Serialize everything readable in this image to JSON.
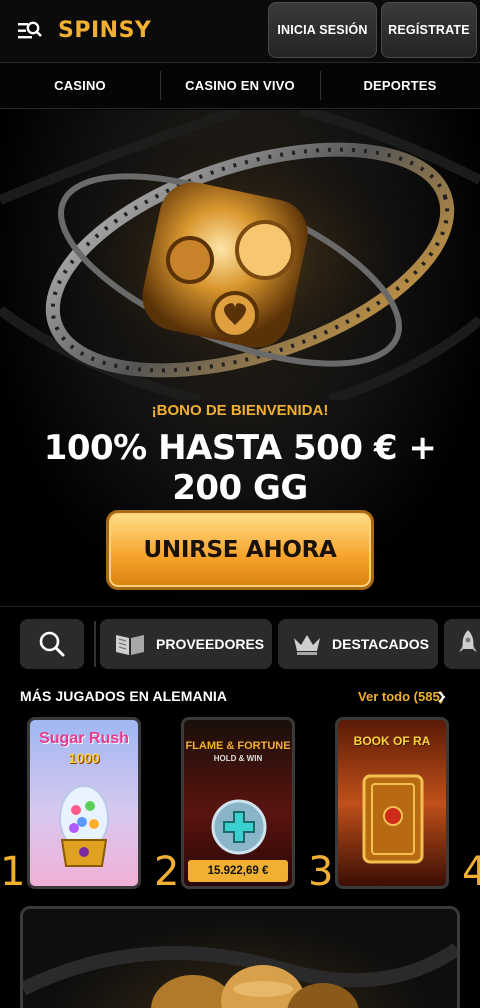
{
  "header": {
    "logo": "SPINSY",
    "login_label": "INICIA SESIÓN",
    "register_label": "REGÍSTRATE",
    "menu_icon": "menu-search-icon"
  },
  "nav": {
    "items": [
      "CASINO",
      "CASINO EN VIVO",
      "DEPORTES"
    ]
  },
  "hero": {
    "bonus_label": "¡BONO DE BIENVENIDA!",
    "bonus_title": "100% HASTA 500 € + 200 GG",
    "cta_label": "UNIRSE AHORA"
  },
  "filters": {
    "search_icon": "search-icon",
    "chips": [
      {
        "label": "PROVEEDORES",
        "icon": "book-icon"
      },
      {
        "label": "DESTACADOS",
        "icon": "crown-icon"
      },
      {
        "label": "",
        "icon": "rocket-icon"
      }
    ]
  },
  "section": {
    "title": "MÁS JUGADOS EN ALEMANIA",
    "see_all": "Ver todo (585)"
  },
  "games": [
    {
      "rank": "1",
      "title_line1": "Sugar Rush",
      "title_line2": "1000",
      "jackpot": ""
    },
    {
      "rank": "2",
      "title_line1": "FLAME & FORTUNE",
      "title_line2": "HOLD & WIN",
      "jackpot": "15.922,69 €"
    },
    {
      "rank": "3",
      "title_line1": "BOOK OF RA",
      "title_line2": "",
      "jackpot": ""
    },
    {
      "rank": "4",
      "title_line1": "",
      "title_line2": "",
      "jackpot": ""
    }
  ],
  "colors": {
    "accent": "#f2b033",
    "background": "#000000",
    "button_dark": "#2b2b2b"
  }
}
